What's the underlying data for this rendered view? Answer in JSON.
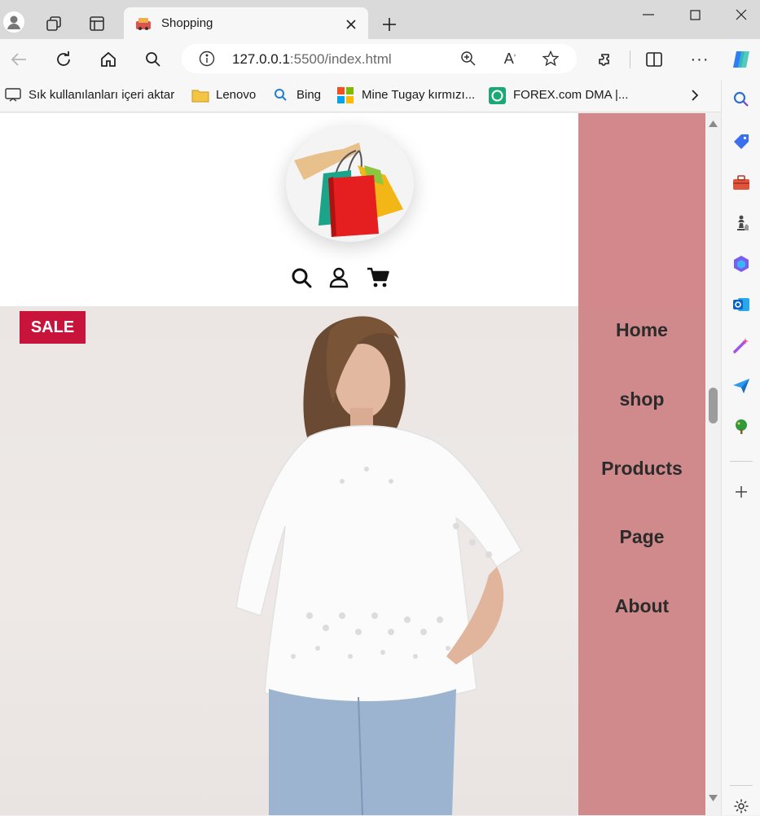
{
  "browser": {
    "tab_title": "Shopping",
    "address": {
      "host": "127.0.0.1",
      "rest": ":5500/index.html"
    },
    "bookmarks": [
      "Sık kullanılanları içeri aktar",
      "Lenovo",
      "Bing",
      "Mine Tugay kırmızı...",
      "FOREX.com DMA |..."
    ]
  },
  "page": {
    "sale_badge": "SALE",
    "nav": [
      "Home",
      "shop",
      "Products",
      "Page",
      "About"
    ]
  },
  "colors": {
    "nav_bg": "#d08a8b",
    "sale": "#c8133a"
  }
}
